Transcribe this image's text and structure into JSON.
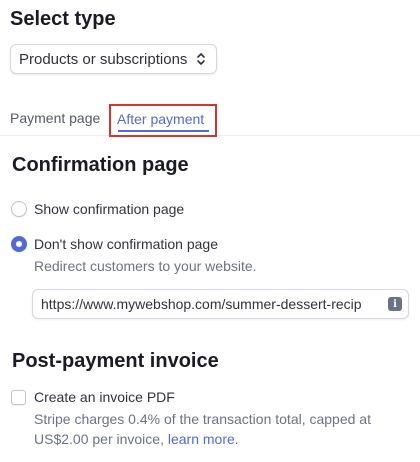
{
  "select_type": {
    "heading": "Select type",
    "selected_value": "Products or subscriptions"
  },
  "tabs": [
    {
      "label": "Payment page",
      "active": false
    },
    {
      "label": "After payment",
      "active": true
    }
  ],
  "confirmation": {
    "heading": "Confirmation page",
    "options": [
      {
        "label": "Show confirmation page",
        "selected": false
      },
      {
        "label": "Don't show confirmation page",
        "selected": true
      }
    ],
    "redirect_description": "Redirect customers to your website.",
    "url_value": "https://www.mywebshop.com/summer-dessert-recip"
  },
  "invoice": {
    "heading": "Post-payment invoice",
    "checkbox_label": "Create an invoice PDF",
    "checked": false,
    "description_prefix": "Stripe charges 0.4% of the transaction total, capped at US$2.00 per invoice, ",
    "link_text": "learn more",
    "description_suffix": "."
  },
  "colors": {
    "accent": "#5469d4",
    "highlight_box": "#d8352a"
  },
  "icons": {
    "select_chevrons": "updown-chevron-icon",
    "url_info": "info-icon"
  }
}
